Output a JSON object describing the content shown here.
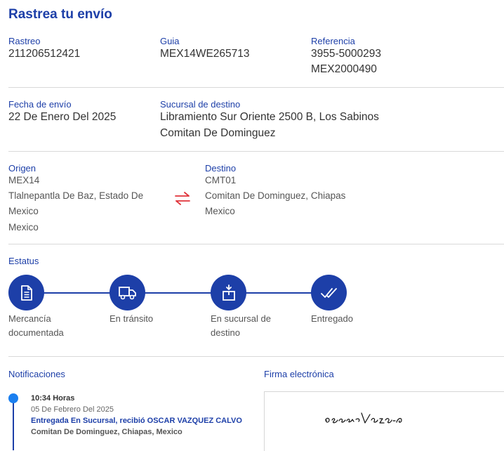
{
  "title": "Rastrea tu envío",
  "rastreo": {
    "label": "Rastreo",
    "value": "211206512421"
  },
  "guia": {
    "label": "Guia",
    "value": "MEX14WE265713"
  },
  "referencia": {
    "label": "Referencia",
    "line1": "3955-5000293",
    "line2": "MEX2000490"
  },
  "fecha_envio": {
    "label": "Fecha de envío",
    "value": "22 De Enero Del 2025"
  },
  "sucursal_destino": {
    "label": "Sucursal de destino",
    "line1": "Libramiento Sur Oriente 2500 B, Los Sabinos",
    "line2": "Comitan De Dominguez"
  },
  "origen": {
    "label": "Origen",
    "code": "MEX14",
    "line1": "Tlalnepantla De Baz, Estado De",
    "line2": "Mexico",
    "line3": "Mexico"
  },
  "destino": {
    "label": "Destino",
    "code": "CMT01",
    "line1": "Comitan De Dominguez, Chiapas",
    "line2": "Mexico"
  },
  "estatus": {
    "label": "Estatus",
    "steps": [
      {
        "line1": "Mercancía",
        "line2": "documentada",
        "icon": "document-icon"
      },
      {
        "line1": "En tránsito",
        "line2": "",
        "icon": "truck-icon"
      },
      {
        "line1": "En sucursal de",
        "line2": "destino",
        "icon": "package-icon"
      },
      {
        "line1": "Entregado",
        "line2": "",
        "icon": "double-check-icon"
      }
    ]
  },
  "notificaciones": {
    "label": "Notificaciones",
    "items": [
      {
        "time": "10:34 Horas",
        "date": "05 De Febrero Del 2025",
        "status": "Entregada En Sucursal, recibió OSCAR VAZQUEZ CALVO",
        "location": "Comitan De Dominguez, Chiapas, Mexico"
      }
    ]
  },
  "firma": {
    "label": "Firma electrónica",
    "signature": "oscar Vazquez C"
  },
  "colors": {
    "accent": "#1d3fa8",
    "dot": "#1a7ff0",
    "swap": "#e0333a"
  }
}
